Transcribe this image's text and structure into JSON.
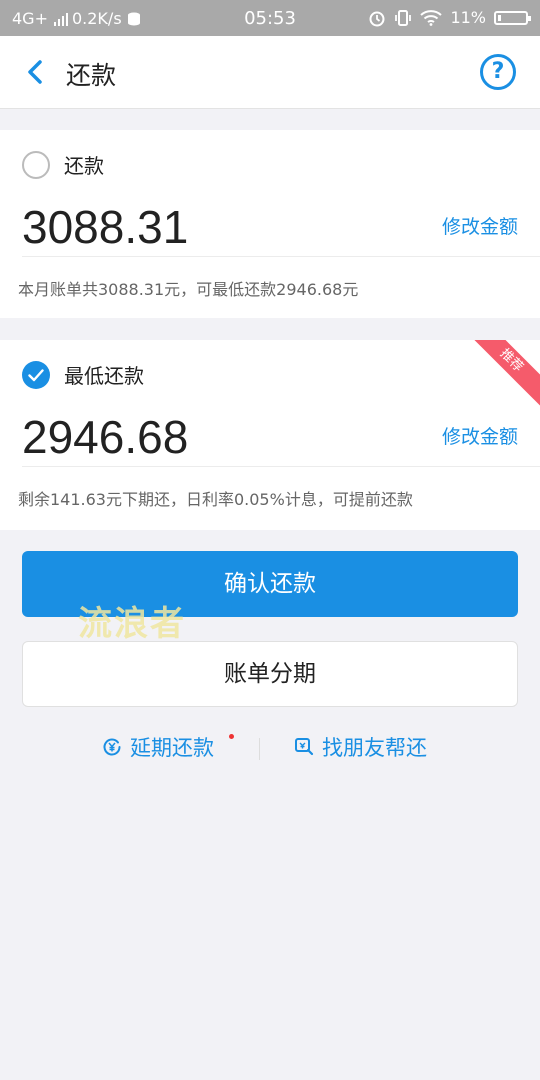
{
  "status_bar": {
    "network": "4G+",
    "speed": "0.2K/s",
    "time": "05:53",
    "battery": "11%"
  },
  "nav": {
    "title": "还款"
  },
  "options": [
    {
      "label": "还款",
      "amount": "3088.31",
      "modify_label": "修改金额",
      "note": "本月账单共3088.31元，可最低还款2946.68元",
      "checked": false
    },
    {
      "label": "最低还款",
      "amount": "2946.68",
      "modify_label": "修改金额",
      "note": "剩余141.63元下期还，日利率0.05%计息，可提前还款",
      "checked": true,
      "badge": "推荐"
    }
  ],
  "actions": {
    "confirm_label": "确认还款",
    "installment_label": "账单分期",
    "watermark": "流浪者",
    "defer_label": "延期还款",
    "friend_label": "找朋友帮还"
  },
  "colors": {
    "accent": "#1a8fe3",
    "badge": "#f55b6b",
    "status_bar": "#a9a9a9",
    "background": "#f2f2f6"
  },
  "battery_level": 0.11
}
